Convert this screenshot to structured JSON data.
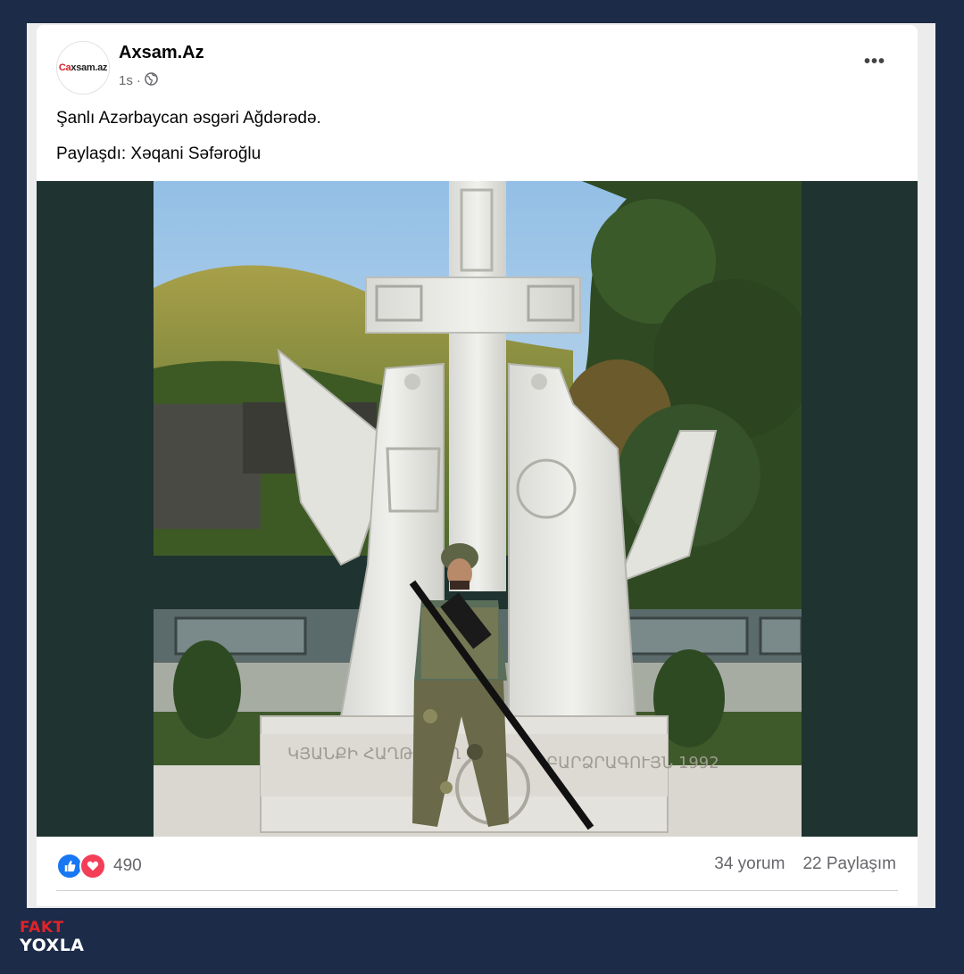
{
  "post": {
    "author": "Axsam.Az",
    "avatar_text_red": "Ca",
    "avatar_text": "xsam.az",
    "time": "1s",
    "audience_icon": "globe-icon",
    "more_icon": "more-icon",
    "more_label": "•••",
    "text_line1": "Şanlı Azərbaycan əsgəri Ağdərədə.",
    "text_line2": "Paylaşdı: Xəqani Səfəroğlu",
    "image_inscription_left": "ԿՅԱՆՔԻ ՀԱՂԹԱԿՈՂ",
    "image_inscription_right": "ԲԱՐՁՐԱԳՈՒՅՆ 1992"
  },
  "reactions": {
    "icons": [
      "like-icon",
      "love-icon"
    ],
    "count": "490"
  },
  "stats": {
    "comments": "34 yorum",
    "shares": "22 Paylaşım"
  },
  "watermark": {
    "line1": "FAKT",
    "line2": "YOXLA"
  },
  "colors": {
    "background": "#1c2b48",
    "like": "#1877f2",
    "love": "#f33e58",
    "watermark_red": "#e0232a"
  }
}
